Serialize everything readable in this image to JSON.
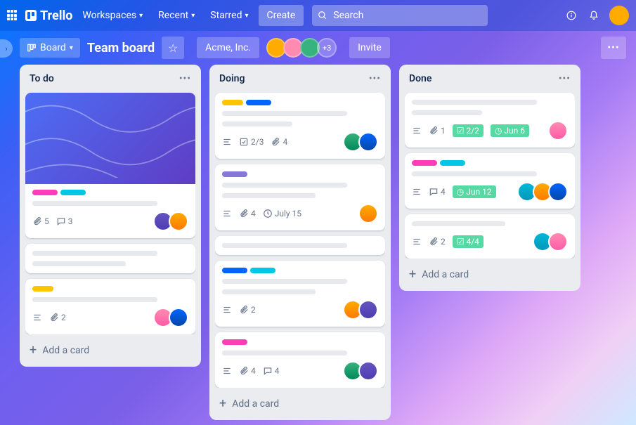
{
  "app": {
    "name": "Trello"
  },
  "nav": {
    "workspaces": "Workspaces",
    "recent": "Recent",
    "starred": "Starred",
    "create": "Create"
  },
  "search": {
    "placeholder": "Search"
  },
  "board": {
    "switch_label": "Board",
    "title": "Team board",
    "workspace": "Acme, Inc.",
    "invite": "Invite",
    "member_overflow": "+3"
  },
  "lists": {
    "todo": {
      "title": "To do",
      "add": "Add a card",
      "cards": [
        {
          "attachments": "5",
          "comments": "3"
        },
        {},
        {
          "attachments": "2"
        }
      ]
    },
    "doing": {
      "title": "Doing",
      "add": "Add a card",
      "cards": [
        {
          "checklist": "2/3",
          "attachments": "4"
        },
        {
          "attachments": "4",
          "due": "July 15"
        },
        {},
        {
          "attachments": "2"
        },
        {
          "attachments": "4",
          "comments": "4"
        }
      ]
    },
    "done": {
      "title": "Done",
      "add": "Add a card",
      "cards": [
        {
          "attachments": "1",
          "checklist": "2/2",
          "due": "Jun 6"
        },
        {
          "comments": "4",
          "due": "Jun 12"
        },
        {
          "attachments": "2",
          "checklist": "4/4"
        }
      ]
    }
  }
}
